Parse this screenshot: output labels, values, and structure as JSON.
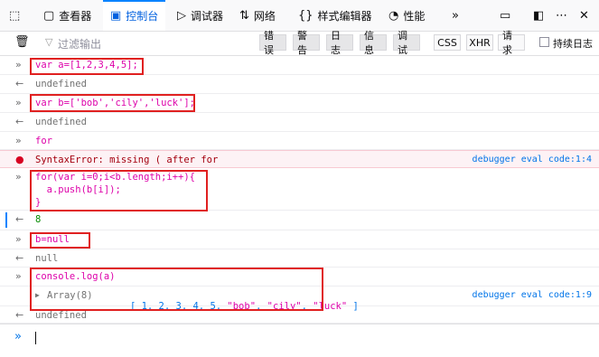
{
  "tabs": [
    {
      "label": "查看器",
      "icon": "inspector-icon"
    },
    {
      "label": "控制台",
      "icon": "console-icon"
    },
    {
      "label": "调试器",
      "icon": "debugger-icon"
    },
    {
      "label": "网络",
      "icon": "network-icon"
    },
    {
      "label": "样式编辑器",
      "icon": "style-editor-icon"
    },
    {
      "label": "性能",
      "icon": "performance-icon"
    }
  ],
  "toolbar": {
    "filter_placeholder": "过滤输出",
    "levels": [
      "错误",
      "警告",
      "日志",
      "信息",
      "调试"
    ],
    "types": [
      "CSS",
      "XHR",
      "请求"
    ],
    "persist_label": "持续日志"
  },
  "console": {
    "rows": [
      {
        "kind": "input",
        "text": "var a=[1,2,3,4,5];"
      },
      {
        "kind": "output",
        "text": "undefined"
      },
      {
        "kind": "input",
        "text": "var b=['bob','cily','luck'];"
      },
      {
        "kind": "output",
        "text": "undefined"
      },
      {
        "kind": "input",
        "text": "for"
      },
      {
        "kind": "error",
        "text": "SyntaxError: missing ( after for",
        "location": "debugger eval code:1:4"
      },
      {
        "kind": "input",
        "lines": [
          "for(var i=0;i<b.length;i++){",
          "  a.push(b[i]);",
          "}"
        ]
      },
      {
        "kind": "output",
        "text": "8"
      },
      {
        "kind": "input",
        "text": "b=null"
      },
      {
        "kind": "output",
        "text": "null"
      },
      {
        "kind": "input",
        "text": "console.log(a)"
      },
      {
        "kind": "log",
        "prefix": "Array(8)",
        "array": [
          "[ 1, 2, 3, 4, 5, ",
          "\"bob\"",
          ", ",
          "\"cily\"",
          ", ",
          "\"luck\"",
          " ]"
        ],
        "location": "debugger eval code:1:9"
      },
      {
        "kind": "output",
        "text": "undefined"
      }
    ]
  },
  "colors": {
    "accent": "#0a84ff",
    "highlight_box": "#e02020",
    "error_text": "#a4000f"
  }
}
